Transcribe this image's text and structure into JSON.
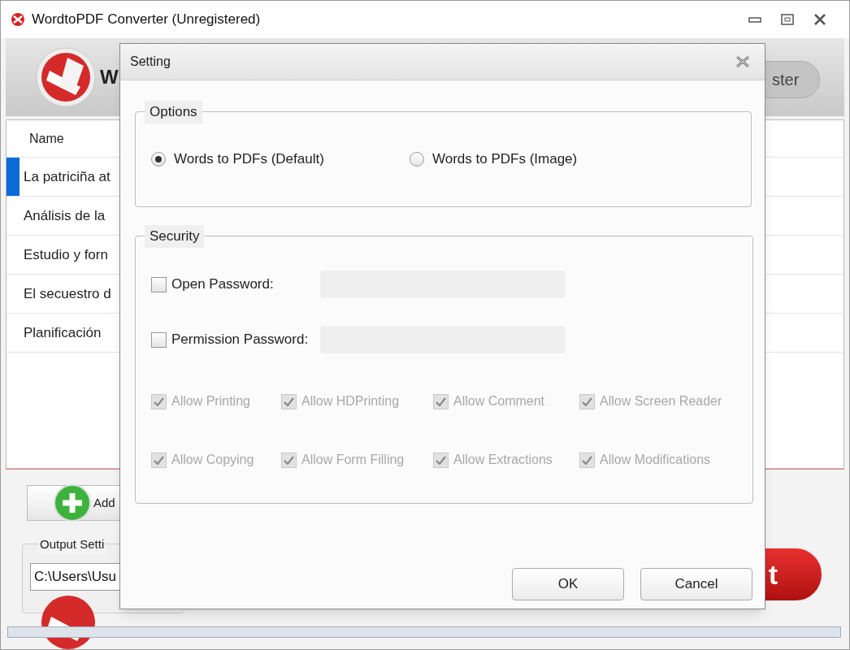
{
  "window": {
    "title": "WordtoPDF Converter (Unregistered)"
  },
  "header": {
    "app_name": "W",
    "register_button": "ster"
  },
  "file_list": {
    "columns": [
      "Name"
    ],
    "rows": [
      {
        "name": "La patriciña at",
        "selected": true
      },
      {
        "name": "Análisis de la",
        "selected": false
      },
      {
        "name": "Estudio y forn",
        "selected": false
      },
      {
        "name": "El secuestro d",
        "selected": false
      },
      {
        "name": "Planificación",
        "selected": false
      }
    ]
  },
  "add_button": "Add",
  "output_settings": {
    "label": "Output Setti",
    "path": "C:\\Users\\Usu"
  },
  "convert_button": "t",
  "progress": {
    "level": 0
  },
  "dialog": {
    "title": "Setting",
    "options": {
      "label": "Options",
      "choices": [
        {
          "label": "Words to PDFs (Default)",
          "selected": true
        },
        {
          "label": "Words to PDFs (Image)",
          "selected": false
        }
      ]
    },
    "security": {
      "label": "Security",
      "passwords": [
        {
          "label": "Open Password:",
          "checked": false
        },
        {
          "label": "Permission Password:",
          "checked": false
        }
      ],
      "permissions": [
        {
          "label": "Allow Printing",
          "checked": true,
          "disabled": true
        },
        {
          "label": "Allow HDPrinting",
          "checked": true,
          "disabled": true
        },
        {
          "label": "Allow Comment",
          "checked": true,
          "disabled": true
        },
        {
          "label": "Allow Screen Reader",
          "checked": true,
          "disabled": true
        },
        {
          "label": "Allow Copying",
          "checked": true,
          "disabled": true
        },
        {
          "label": "Allow Form Filling",
          "checked": true,
          "disabled": true
        },
        {
          "label": "Allow Extractions",
          "checked": true,
          "disabled": true
        },
        {
          "label": "Allow Modifications",
          "checked": true,
          "disabled": true
        }
      ]
    },
    "buttons": [
      "OK",
      "Cancel"
    ]
  }
}
